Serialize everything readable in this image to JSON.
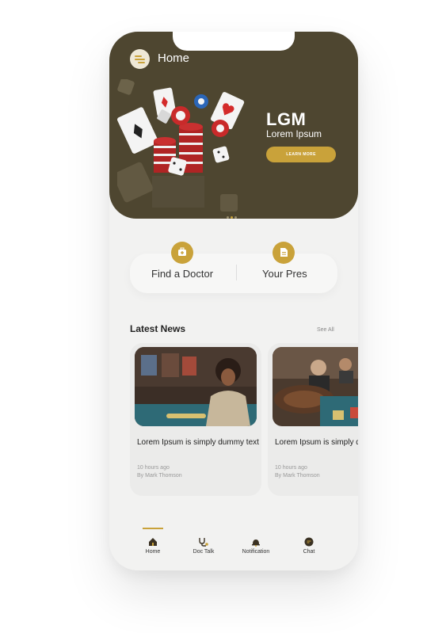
{
  "header": {
    "title": "Home"
  },
  "hero": {
    "brand": "LGM",
    "subtitle": "Lorem Ipsum",
    "button_label": "LEARN MORE",
    "slide_count": 3,
    "active_slide": 1
  },
  "quick_actions": [
    {
      "label": "Find a Doctor",
      "icon": "first-aid-icon"
    },
    {
      "label": "Your Pres",
      "icon": "document-icon"
    }
  ],
  "news": {
    "heading": "Latest News",
    "see_all": "See All",
    "items": [
      {
        "title": "Lorem Ipsum is simply dummy text of the printing",
        "time": "10 hours ago",
        "author": "By Mark Thomson"
      },
      {
        "title": "Lorem Ipsum is simply dummy text of the printing",
        "time": "10 hours ago",
        "author": "By Mark Thomson"
      }
    ]
  },
  "bottom_nav": [
    {
      "label": "Home",
      "icon": "home-icon",
      "active": true
    },
    {
      "label": "Doc Talk",
      "icon": "stethoscope-icon",
      "active": false
    },
    {
      "label": "Notification",
      "icon": "bell-icon",
      "active": false
    },
    {
      "label": "Chat",
      "icon": "chat-icon",
      "active": false
    }
  ],
  "colors": {
    "hero_bg": "#4e4630",
    "accent": "#c9a23a",
    "background": "#f2f2f1"
  }
}
